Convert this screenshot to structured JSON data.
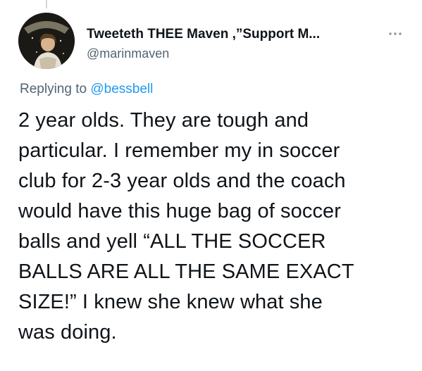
{
  "tweet": {
    "author": {
      "display_name": "Tweeteth THEE Maven ,”Support M...",
      "handle": "@marinmaven",
      "avatar_icon": "profile-photo"
    },
    "more_icon": "more-horizontal-icon",
    "replying": {
      "prefix": "Replying to",
      "mention": "@bessbell"
    },
    "text_lines": [
      "2 year olds. They are tough and",
      "particular. I remember my in soccer",
      "club for 2-3 year olds and the coach",
      "would have this huge bag of soccer",
      "balls and yell “ALL THE SOCCER",
      "BALLS ARE ALL THE SAME EXACT",
      "SIZE!” I knew she knew what she",
      "was doing."
    ]
  },
  "colors": {
    "text": "#0f1419",
    "secondary": "#536471",
    "link": "#1d9bf0",
    "thread_line": "#cfd9de"
  }
}
